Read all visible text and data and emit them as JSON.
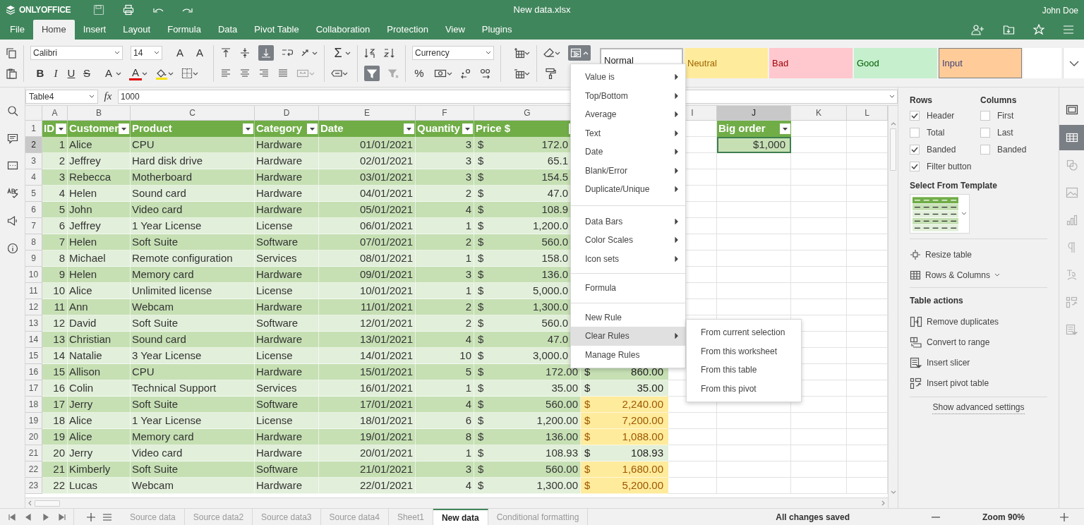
{
  "app": {
    "logo": "ONLYOFFICE",
    "title": "New data.xlsx",
    "user": "John Doe"
  },
  "menu_tabs": [
    {
      "label": "File",
      "selected": false
    },
    {
      "label": "Home",
      "selected": true
    },
    {
      "label": "Insert",
      "selected": false
    },
    {
      "label": "Layout",
      "selected": false
    },
    {
      "label": "Formula",
      "selected": false
    },
    {
      "label": "Data",
      "selected": false
    },
    {
      "label": "Pivot Table",
      "selected": false
    },
    {
      "label": "Collaboration",
      "selected": false
    },
    {
      "label": "Protection",
      "selected": false
    },
    {
      "label": "View",
      "selected": false
    },
    {
      "label": "Plugins",
      "selected": false
    }
  ],
  "toolbar": {
    "font": "Calibri",
    "font_size": "14",
    "number_format": "Currency",
    "glyphs": {
      "grow": "A",
      "shrink": "A",
      "subscript": "A",
      "font_color": "A",
      "sum": "Σ",
      "percent": "%"
    },
    "text_format": [
      {
        "glyph": "B",
        "kind": "bold"
      },
      {
        "glyph": "I",
        "kind": "italic"
      },
      {
        "glyph": "U",
        "kind": "underline"
      },
      {
        "glyph": "S",
        "kind": "strike"
      }
    ],
    "align_bottom_pressed": true,
    "filter_pressed": true,
    "conditional_formatting_pressed": true
  },
  "cell_styles": [
    {
      "label": "Normal",
      "kind": "normal"
    },
    {
      "label": "Neutral",
      "kind": "neutral"
    },
    {
      "label": "Bad",
      "kind": "bad"
    },
    {
      "label": "Good",
      "kind": "good"
    },
    {
      "label": "Input",
      "kind": "input"
    },
    {
      "kind": "empty"
    }
  ],
  "formula_bar": {
    "name_box": "Table4",
    "fx": "fx",
    "formula": "1000"
  },
  "columns": [
    {
      "label": "A",
      "selected": false
    },
    {
      "label": "B",
      "selected": false
    },
    {
      "label": "C",
      "selected": false
    },
    {
      "label": "D",
      "selected": false
    },
    {
      "label": "E",
      "selected": false
    },
    {
      "label": "F",
      "selected": false
    },
    {
      "label": "G",
      "selected": false
    },
    {
      "label": "I",
      "selected": false
    },
    {
      "label": "J",
      "selected": true
    },
    {
      "label": "K",
      "selected": false
    },
    {
      "label": "L",
      "selected": false
    }
  ],
  "table": {
    "header_row": "1",
    "headers": [
      "ID",
      "Customer",
      "Product",
      "Category",
      "Date",
      "Quantity",
      "Price $"
    ],
    "rows": [
      {
        "row": "2",
        "selected": true,
        "id": "1",
        "customer": "Alice",
        "product": "CPU",
        "category": "Hardware",
        "date": "01/01/2021",
        "quantity": "3",
        "currency": "$",
        "price": "172.0"
      },
      {
        "row": "3",
        "selected": false,
        "id": "2",
        "customer": "Jeffrey",
        "product": "Hard disk drive",
        "category": "Hardware",
        "date": "02/01/2021",
        "quantity": "3",
        "currency": "$",
        "price": "65.1"
      },
      {
        "row": "4",
        "selected": false,
        "id": "3",
        "customer": "Rebecca",
        "product": "Motherboard",
        "category": "Hardware",
        "date": "03/01/2021",
        "quantity": "3",
        "currency": "$",
        "price": "154.5"
      },
      {
        "row": "5",
        "selected": false,
        "id": "4",
        "customer": "Helen",
        "product": "Sound card",
        "category": "Hardware",
        "date": "04/01/2021",
        "quantity": "2",
        "currency": "$",
        "price": "47.0"
      },
      {
        "row": "6",
        "selected": false,
        "id": "5",
        "customer": "John",
        "product": "Video card",
        "category": "Hardware",
        "date": "05/01/2021",
        "quantity": "4",
        "currency": "$",
        "price": "108.9"
      },
      {
        "row": "7",
        "selected": false,
        "id": "6",
        "customer": "Jeffrey",
        "product": "1 Year License",
        "category": "License",
        "date": "06/01/2021",
        "quantity": "1",
        "currency": "$",
        "price": "1,200.0"
      },
      {
        "row": "8",
        "selected": false,
        "id": "7",
        "customer": "Helen",
        "product": "Soft Suite",
        "category": "Software",
        "date": "07/01/2021",
        "quantity": "2",
        "currency": "$",
        "price": "560.0"
      },
      {
        "row": "9",
        "selected": false,
        "id": "8",
        "customer": "Michael",
        "product": "Remote configuration",
        "category": "Services",
        "date": "08/01/2021",
        "quantity": "1",
        "currency": "$",
        "price": "158.0"
      },
      {
        "row": "10",
        "selected": false,
        "id": "9",
        "customer": "Helen",
        "product": "Memory card",
        "category": "Hardware",
        "date": "09/01/2021",
        "quantity": "3",
        "currency": "$",
        "price": "136.0"
      },
      {
        "row": "11",
        "selected": false,
        "id": "10",
        "customer": "Alice",
        "product": "Unlimited license",
        "category": "License",
        "date": "10/01/2021",
        "quantity": "1",
        "currency": "$",
        "price": "5,000.0"
      },
      {
        "row": "12",
        "selected": false,
        "id": "11",
        "customer": "Ann",
        "product": "Webcam",
        "category": "Hardware",
        "date": "11/01/2021",
        "quantity": "2",
        "currency": "$",
        "price": "1,300.0"
      },
      {
        "row": "13",
        "selected": false,
        "id": "12",
        "customer": "David",
        "product": "Soft Suite",
        "category": "Software",
        "date": "12/01/2021",
        "quantity": "2",
        "currency": "$",
        "price": "560.0"
      },
      {
        "row": "14",
        "selected": false,
        "id": "13",
        "customer": "Christian",
        "product": "Sound card",
        "category": "Hardware",
        "date": "13/01/2021",
        "quantity": "4",
        "currency": "$",
        "price": "47.0"
      },
      {
        "row": "15",
        "selected": false,
        "id": "14",
        "customer": "Natalie",
        "product": "3 Year License",
        "category": "License",
        "date": "14/01/2021",
        "quantity": "10",
        "currency": "$",
        "price": "3,000.0"
      },
      {
        "row": "16",
        "selected": false,
        "id": "15",
        "customer": "Allison",
        "product": "CPU",
        "category": "Hardware",
        "date": "15/01/2021",
        "quantity": "5",
        "currency": "$",
        "price": "172.00",
        "total_currency": "$",
        "total": "860.00",
        "total_highlight": false
      },
      {
        "row": "17",
        "selected": false,
        "id": "16",
        "customer": "Colin",
        "product": "Technical Support",
        "category": "Services",
        "date": "16/01/2021",
        "quantity": "1",
        "currency": "$",
        "price": "35.00",
        "total_currency": "$",
        "total": "35.00",
        "total_highlight": false
      },
      {
        "row": "18",
        "selected": false,
        "id": "17",
        "customer": "Jerry",
        "product": "Soft Suite",
        "category": "Software",
        "date": "17/01/2021",
        "quantity": "4",
        "currency": "$",
        "price": "560.00",
        "total_currency": "$",
        "total": "2,240.00",
        "total_highlight": true
      },
      {
        "row": "19",
        "selected": false,
        "id": "18",
        "customer": "Alice",
        "product": "1 Year License",
        "category": "License",
        "date": "18/01/2021",
        "quantity": "6",
        "currency": "$",
        "price": "1,200.00",
        "total_currency": "$",
        "total": "7,200.00",
        "total_highlight": true
      },
      {
        "row": "20",
        "selected": false,
        "id": "19",
        "customer": "Alice",
        "product": "Memory card",
        "category": "Hardware",
        "date": "19/01/2021",
        "quantity": "8",
        "currency": "$",
        "price": "136.00",
        "total_currency": "$",
        "total": "1,088.00",
        "total_highlight": true
      },
      {
        "row": "21",
        "selected": false,
        "id": "20",
        "customer": "Jerry",
        "product": "Video card",
        "category": "Hardware",
        "date": "20/01/2021",
        "quantity": "1",
        "currency": "$",
        "price": "108.93",
        "total_currency": "$",
        "total": "108.93",
        "total_highlight": false
      },
      {
        "row": "22",
        "selected": false,
        "id": "21",
        "customer": "Kimberly",
        "product": "Soft Suite",
        "category": "Software",
        "date": "21/01/2021",
        "quantity": "3",
        "currency": "$",
        "price": "560.00",
        "total_currency": "$",
        "total": "1,680.00",
        "total_highlight": true
      },
      {
        "row": "23",
        "selected": false,
        "id": "22",
        "customer": "Lucas",
        "product": "Webcam",
        "category": "Hardware",
        "date": "22/01/2021",
        "quantity": "4",
        "currency": "$",
        "price": "1,300.00",
        "total_currency": "$",
        "total": "5,200.00",
        "total_highlight": true
      }
    ]
  },
  "criteria": {
    "header": "Big order",
    "value": "$1,000",
    "selected": true
  },
  "conditional_menu": {
    "groups": [
      [
        {
          "label": "Value is",
          "submenu": true,
          "selected": false
        },
        {
          "label": "Top/Bottom",
          "submenu": true,
          "selected": false
        },
        {
          "label": "Average",
          "submenu": true,
          "selected": false
        },
        {
          "label": "Text",
          "submenu": true,
          "selected": false
        },
        {
          "label": "Date",
          "submenu": true,
          "selected": false
        },
        {
          "label": "Blank/Error",
          "submenu": true,
          "selected": false
        },
        {
          "label": "Duplicate/Unique",
          "submenu": true,
          "selected": false
        }
      ],
      [
        {
          "label": "Data Bars",
          "submenu": true,
          "selected": false
        },
        {
          "label": "Color Scales",
          "submenu": true,
          "selected": false
        },
        {
          "label": "Icon sets",
          "submenu": true,
          "selected": false
        }
      ],
      [
        {
          "label": "Formula",
          "submenu": false,
          "selected": false
        }
      ],
      [
        {
          "label": "New Rule",
          "submenu": false,
          "selected": false
        },
        {
          "label": "Clear Rules",
          "submenu": true,
          "selected": true
        },
        {
          "label": "Manage Rules",
          "submenu": false,
          "selected": false
        }
      ]
    ],
    "submenu": [
      "From current selection",
      "From this worksheet",
      "From this table",
      "From this pivot"
    ]
  },
  "table_settings": {
    "rows_title": "Rows",
    "columns_title": "Columns",
    "rows": [
      {
        "label": "Header",
        "checked": true
      },
      {
        "label": "Total",
        "checked": false
      },
      {
        "label": "Banded",
        "checked": true
      },
      {
        "label": "Filter button",
        "checked": true
      }
    ],
    "columns": [
      {
        "label": "First",
        "checked": false
      },
      {
        "label": "Last",
        "checked": false
      },
      {
        "label": "Banded",
        "checked": false
      }
    ],
    "template_title": "Select From Template",
    "resize": "Resize table",
    "rows_columns": "Rows & Columns",
    "actions_title": "Table actions",
    "actions": [
      "Remove duplicates",
      "Convert to range",
      "Insert slicer",
      "Insert pivot table"
    ],
    "advanced": "Show advanced settings"
  },
  "side_tabs": [
    {
      "selected": false
    },
    {
      "selected": true
    },
    {
      "selected": false
    },
    {
      "selected": false
    },
    {
      "selected": false
    },
    {
      "selected": false
    },
    {
      "selected": false
    },
    {
      "selected": false
    },
    {
      "selected": false
    }
  ],
  "sheet_tabs": [
    {
      "label": "Source data",
      "selected": false
    },
    {
      "label": "Source data2",
      "selected": false
    },
    {
      "label": "Source data3",
      "selected": false
    },
    {
      "label": "Source data4",
      "selected": false
    },
    {
      "label": "Sheet1",
      "selected": false
    },
    {
      "label": "New data",
      "selected": true
    },
    {
      "label": "Conditional formatting",
      "selected": false
    }
  ],
  "status": "All changes saved",
  "zoom": "Zoom 90%"
}
